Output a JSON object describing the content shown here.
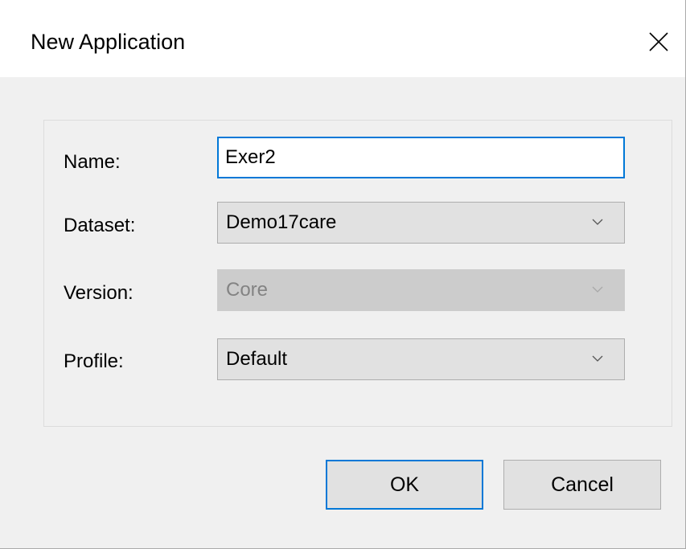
{
  "dialog": {
    "title": "New Application",
    "close_icon": "close-icon"
  },
  "form": {
    "name": {
      "label": "Name:",
      "value": "Exer2"
    },
    "dataset": {
      "label": "Dataset:",
      "value": "Demo17care",
      "enabled": true
    },
    "version": {
      "label": "Version:",
      "value": "Core",
      "enabled": false
    },
    "profile": {
      "label": "Profile:",
      "value": "Default",
      "enabled": true
    }
  },
  "buttons": {
    "ok_label": "OK",
    "cancel_label": "Cancel"
  },
  "colors": {
    "accent": "#0078d7",
    "dialog_bg": "#f0f0f0",
    "combo_bg": "#e1e1e1",
    "disabled_text": "#838383"
  },
  "icons": {
    "dropdown": "chevron-down-icon"
  }
}
